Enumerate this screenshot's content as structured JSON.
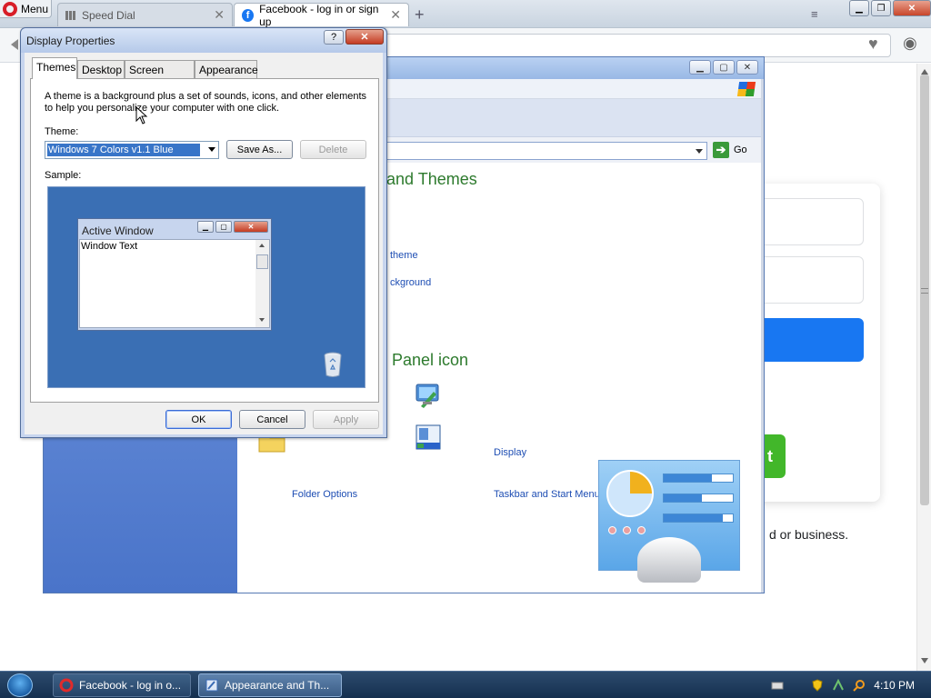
{
  "browser": {
    "menu_label": "Menu",
    "tabs": [
      {
        "label": "Speed Dial",
        "close": "✕"
      },
      {
        "label": "Facebook - log in or sign up",
        "close": "✕"
      }
    ],
    "new_tab_symbol": "+"
  },
  "facebook_page": {
    "create_button_fragment": "t",
    "tagline_fragment": "d or business."
  },
  "control_panel": {
    "address_go": "Go",
    "heading_themes": "and Themes",
    "link_theme": "theme",
    "link_background": "ckground",
    "heading_panel_icon": "Panel icon",
    "item_display": "Display",
    "item_taskbar": "Taskbar and Start Menu",
    "item_folder_options": "Folder Options"
  },
  "display_properties": {
    "title": "Display Properties",
    "help_symbol": "?",
    "close_symbol": "✕",
    "tabs": [
      {
        "label": "Themes",
        "active": true
      },
      {
        "label": "Desktop",
        "active": false
      },
      {
        "label": "Screen Saver",
        "active": false
      },
      {
        "label": "Appearance",
        "active": false
      }
    ],
    "description": "A theme is a background plus a set of sounds, icons, and other elements to help you personalize your computer with one click.",
    "theme_label": "Theme:",
    "theme_value": "Windows 7 Colors v1.1 Blue",
    "save_as": "Save As...",
    "delete": "Delete",
    "sample_label": "Sample:",
    "sample_window_title": "Active Window",
    "sample_window_text": "Window Text",
    "ok": "OK",
    "cancel": "Cancel",
    "apply": "Apply"
  },
  "taskbar": {
    "items": [
      {
        "label": "Facebook - log in o..."
      },
      {
        "label": "Appearance and Th..."
      }
    ],
    "clock": "4:10 PM"
  },
  "colors": {
    "xp_blue": "#0a57d6",
    "facebook_blue": "#1877f2",
    "facebook_green": "#42b72a",
    "cp_heading_green": "#2d7a2d"
  }
}
